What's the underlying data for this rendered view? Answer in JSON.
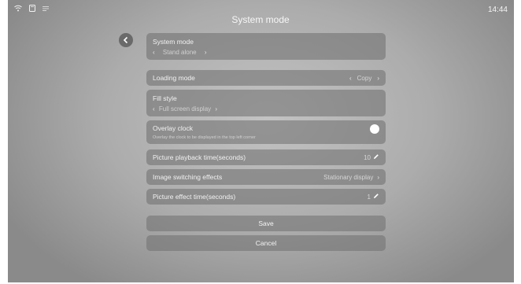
{
  "status_bar": {
    "icons": [
      "wifi-icon",
      "sd-card-icon",
      "menu-lines-icon"
    ],
    "time": "14:44"
  },
  "header": {
    "title": "System mode"
  },
  "settings": {
    "system_mode": {
      "label": "System mode",
      "value": "Stand alone"
    },
    "loading_mode": {
      "label": "Loading mode",
      "value": "Copy"
    },
    "fill_style": {
      "label": "Fill style",
      "value": "Full screen display"
    },
    "overlay_clock": {
      "label": "Overlay clock",
      "description": "Overlay the clock to be displayed in the top left corner",
      "enabled": false
    },
    "picture_playback_time": {
      "label": "Picture playback time(seconds)",
      "value": "10"
    },
    "image_switching_effects": {
      "label": "Image switching effects",
      "value": "Stationary display"
    },
    "picture_effect_time": {
      "label": "Picture effect time(seconds)",
      "value": "1"
    }
  },
  "actions": {
    "save_label": "Save",
    "cancel_label": "Cancel"
  },
  "glyphs": {
    "left": "‹",
    "right": "›"
  }
}
